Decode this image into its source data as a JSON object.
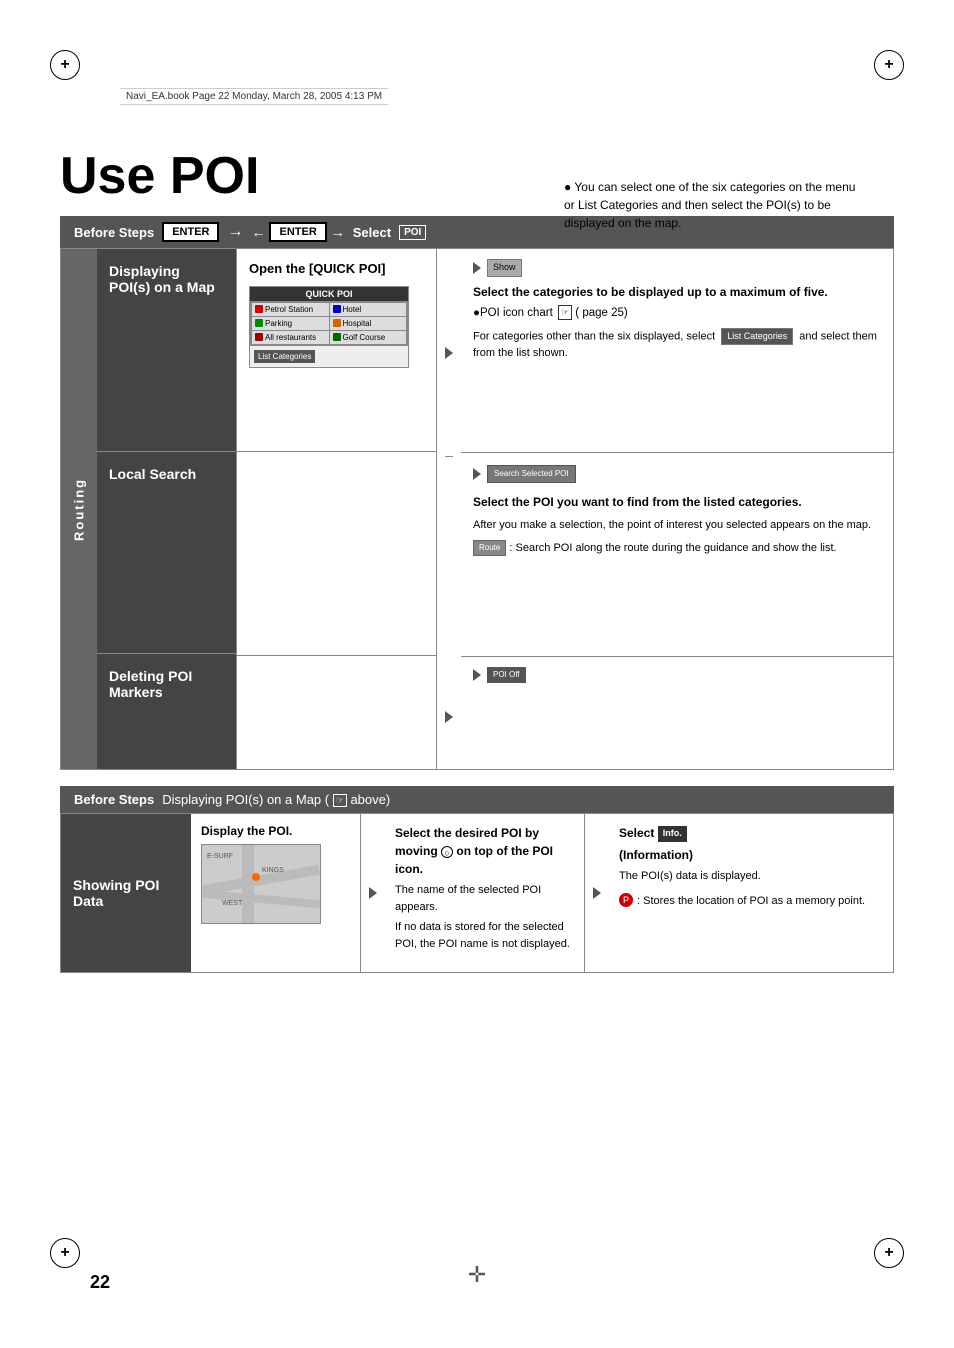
{
  "page": {
    "number": "22",
    "file_info": "Navi_EA.book  Page 22  Monday, March 28, 2005  4:13 PM"
  },
  "title": "Use POI",
  "intro": {
    "bullet": "●",
    "text": "You can select one of the six categories on the menu or List Categories and then select the POI(s) to be displayed on the map."
  },
  "before_steps_1": {
    "label": "Before Steps",
    "enter1": "ENTER",
    "arrow": "→",
    "enter2": "ENTER",
    "select": "Select",
    "poi": "POI"
  },
  "sections": {
    "routing_label": "Routing",
    "displaying": {
      "label": "Displaying POI(s) on a Map",
      "mid_title": "Open the [QUICK POI]",
      "quick_poi": {
        "title": "QUICK POI",
        "cells": [
          {
            "icon": "petrol",
            "label": "Petrol Station"
          },
          {
            "icon": "hotel",
            "label": "Hotel"
          },
          {
            "icon": "parking",
            "label": "Parking"
          },
          {
            "icon": "hospital",
            "label": "Hospital"
          },
          {
            "icon": "restaurant",
            "label": "All restaurants"
          },
          {
            "icon": "golf",
            "label": "Golf Course"
          }
        ],
        "list_cat": "List Categories"
      },
      "right_title": "Select the categories to be displayed up to a maximum of five.",
      "poi_chart": "●POI icon chart",
      "page_ref": "( page 25)",
      "for_cats": "For categories other than the six displayed, select",
      "list_cat_btn": "List Categories",
      "and_select": "and select them from the list shown.",
      "show_btn": "Show"
    },
    "local_search": {
      "label": "Local Search",
      "search_sel_btn": "Search Selected POI",
      "right_title": "Select the POI you want to find from the listed categories.",
      "right_body": "After you make a selection, the point of interest you selected appears on the map.",
      "route_label": "Route",
      "route_desc": ": Search POI along the route during the guidance and show the list."
    },
    "deleting": {
      "label": "Deleting POI Markers",
      "poi_off_btn": "POI Off"
    }
  },
  "before_steps_2": {
    "label": "Before Steps",
    "content": "Displaying POI(s) on a Map (",
    "ref": "above)"
  },
  "showing_poi": {
    "label": "Showing POI Data",
    "step1": {
      "title": "Display the POI."
    },
    "step2": {
      "title": "Select the desired POI by moving",
      "cursor": "⊙",
      "on_text": "on top of the POI icon.",
      "body1": "The name of the selected POI appears.",
      "body2": "If no data is stored for the selected POI, the POI name is not displayed."
    },
    "step3": {
      "title": "Select",
      "info_btn": "Info.",
      "title2": "(Information)",
      "body": "The POI(s) data is displayed.",
      "memory_label": "P",
      "memory_desc": ": Stores the location of POI as a memory point."
    }
  }
}
